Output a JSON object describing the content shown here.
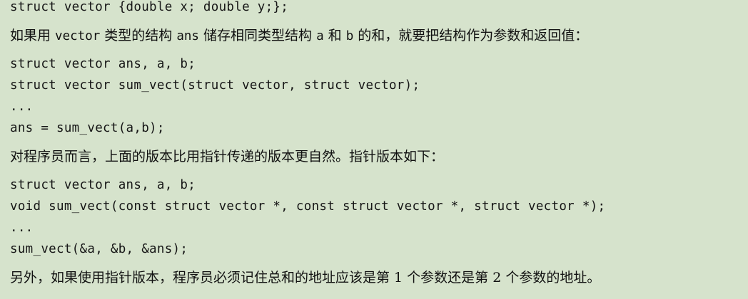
{
  "document": {
    "code_1": {
      "line_1": "struct vector {double x; double y;};"
    },
    "para_1": {
      "t1": "如果用 ",
      "t2": "vector",
      "t3": " 类型的结构 ",
      "t4": "ans",
      "t5": " 储存相同类型结构 ",
      "t6": "a",
      "t7": " 和 ",
      "t8": "b",
      "t9": " 的和，就要把结构作为参数和返回值："
    },
    "code_2": {
      "line_1": "struct vector ans, a, b;",
      "line_2": "struct vector sum_vect(struct vector, struct vector);",
      "line_3": "...",
      "line_4": "ans = sum_vect(a,b);"
    },
    "para_2": {
      "text": "对程序员而言，上面的版本比用指针传递的版本更自然。指针版本如下："
    },
    "code_3": {
      "line_1": "struct vector ans, a, b;",
      "line_2": "void sum_vect(const struct vector *, const struct vector *, struct vector *);",
      "line_3": "...",
      "line_4": "sum_vect(&a, &b, &ans);"
    },
    "para_3": {
      "text": "另外，如果使用指针版本，程序员必须记住总和的地址应该是第 1 个参数还是第 2 个参数的地址。"
    }
  },
  "colors": {
    "background": "#d6e3cc",
    "text": "#141414"
  }
}
